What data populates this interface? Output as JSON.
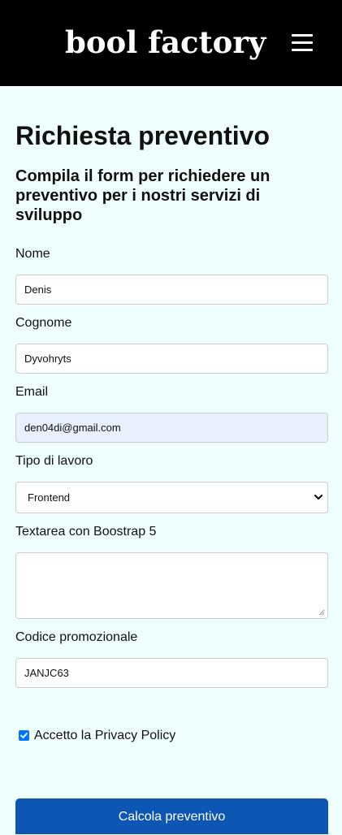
{
  "header": {
    "brand": "bool factory",
    "menu_icon": "hamburger-menu-icon"
  },
  "page": {
    "title": "Richiesta preventivo",
    "subtitle": "Compila il form per richiedere un preventivo per i nostri servizi di sviluppo"
  },
  "form": {
    "nome": {
      "label": "Nome",
      "value": "Denis"
    },
    "cognome": {
      "label": "Cognome",
      "value": "Dyvohryts"
    },
    "email": {
      "label": "Email",
      "value": "den04di@gmail.com"
    },
    "tipo_lavoro": {
      "label": "Tipo di lavoro",
      "selected": "Frontend",
      "icon": "chevron-down-icon"
    },
    "textarea": {
      "label": "Textarea con Boostrap 5",
      "value": ""
    },
    "codice": {
      "label": "Codice promozionale",
      "value": "JANJC63"
    },
    "privacy": {
      "label": "Accetto la Privacy Policy",
      "checked": true
    },
    "submit_label": "Calcola preventivo"
  },
  "colors": {
    "header_bg": "#000000",
    "page_bg": "#eefffe",
    "button_bg": "#0d56b3",
    "checkbox_accent": "#0075ff",
    "autofill_bg": "#e8f0fe"
  }
}
